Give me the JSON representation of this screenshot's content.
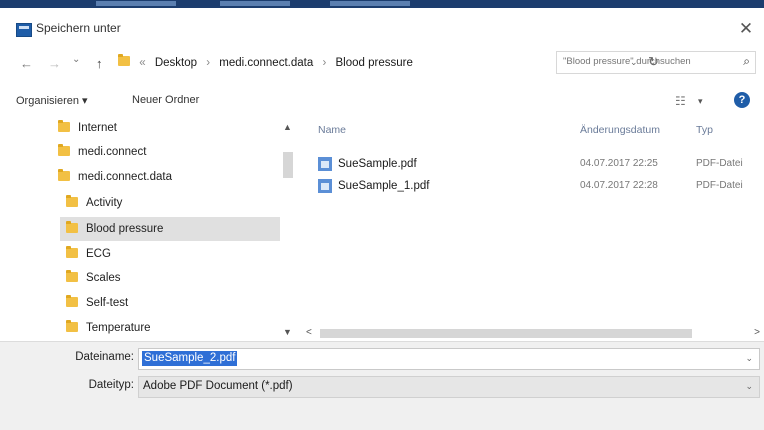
{
  "dialog": {
    "title": "Speichern unter",
    "close_glyph": "✕"
  },
  "nav": {
    "back_glyph": "←",
    "forward_glyph": "→",
    "recent_glyph": "⌄",
    "up_glyph": "↑"
  },
  "address": {
    "prefix": "«",
    "breadcrumbs": [
      "Desktop",
      "medi.connect.data",
      "Blood pressure"
    ],
    "separator": "›",
    "dropdown_glyph": "⌄",
    "refresh_glyph": "↻"
  },
  "search": {
    "placeholder": "\"Blood pressure\" durchsuchen",
    "icon": "⌕"
  },
  "toolbar": {
    "organize_label": "Organisieren ▾",
    "new_folder_label": "Neuer Ordner",
    "view_glyph": "☷",
    "view_dropdown_glyph": "▾",
    "help_glyph": "?"
  },
  "tree": {
    "items": [
      {
        "label": "Internet"
      },
      {
        "label": "medi.connect"
      },
      {
        "label": "medi.connect.data"
      },
      {
        "label": "Activity"
      },
      {
        "label": "Blood pressure"
      },
      {
        "label": "ECG"
      },
      {
        "label": "Scales"
      },
      {
        "label": "Self-test"
      },
      {
        "label": "Temperature"
      }
    ],
    "scroll_up": "▲",
    "scroll_down": "▼"
  },
  "files": {
    "columns": {
      "name": "Name",
      "date": "Änderungsdatum",
      "type": "Typ"
    },
    "rows": [
      {
        "name": "SueSample.pdf",
        "date": "04.07.2017 22:25",
        "type": "PDF-Datei"
      },
      {
        "name": "SueSample_1.pdf",
        "date": "04.07.2017 22:28",
        "type": "PDF-Datei"
      }
    ],
    "scroll_left": "<",
    "scroll_right": ">"
  },
  "form": {
    "filename_label": "Dateiname:",
    "filename_value": "SueSample_2.pdf",
    "filetype_label": "Dateityp:",
    "filetype_value": "Adobe PDF Document (*.pdf)",
    "dropdown_glyph": "⌄"
  },
  "colors": {
    "accent": "#2f6fd6",
    "title_strip": "#1c3d6e",
    "folder": "#f2c044",
    "help": "#1f5da8"
  }
}
